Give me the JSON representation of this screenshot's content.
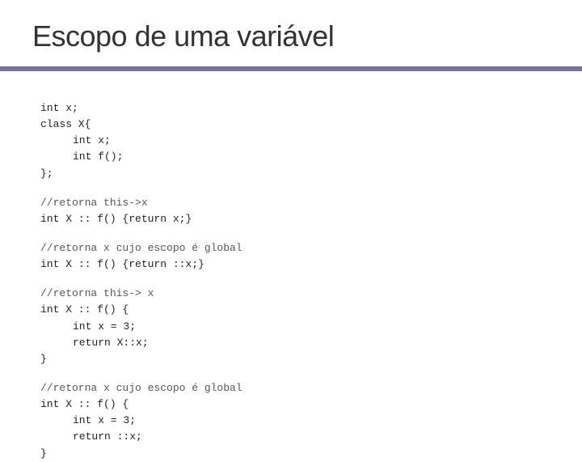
{
  "header": {
    "title": "Escopo de uma variável"
  },
  "accent": {
    "color": "#7a6fa0"
  },
  "code": {
    "section1": {
      "lines": [
        "int x;",
        "class X{",
        "    int x;",
        "    int f();",
        "};"
      ]
    },
    "section2": {
      "comment": "//retorna this->x",
      "code": "int X :: f() {return x;}"
    },
    "section3": {
      "comment": "//retorna x cujo escopo é global",
      "code": "int X :: f() {return ::x;}"
    },
    "section4": {
      "comment": "//retorna this-> x",
      "lines": [
        "int X :: f() {",
        "    int x = 3;",
        "    return X::x;",
        "}"
      ]
    },
    "section5": {
      "comment": "//retorna x cujo escopo é global",
      "lines": [
        "int X :: f() {",
        "    int x = 3;",
        "    return ::x;",
        "}"
      ]
    }
  }
}
